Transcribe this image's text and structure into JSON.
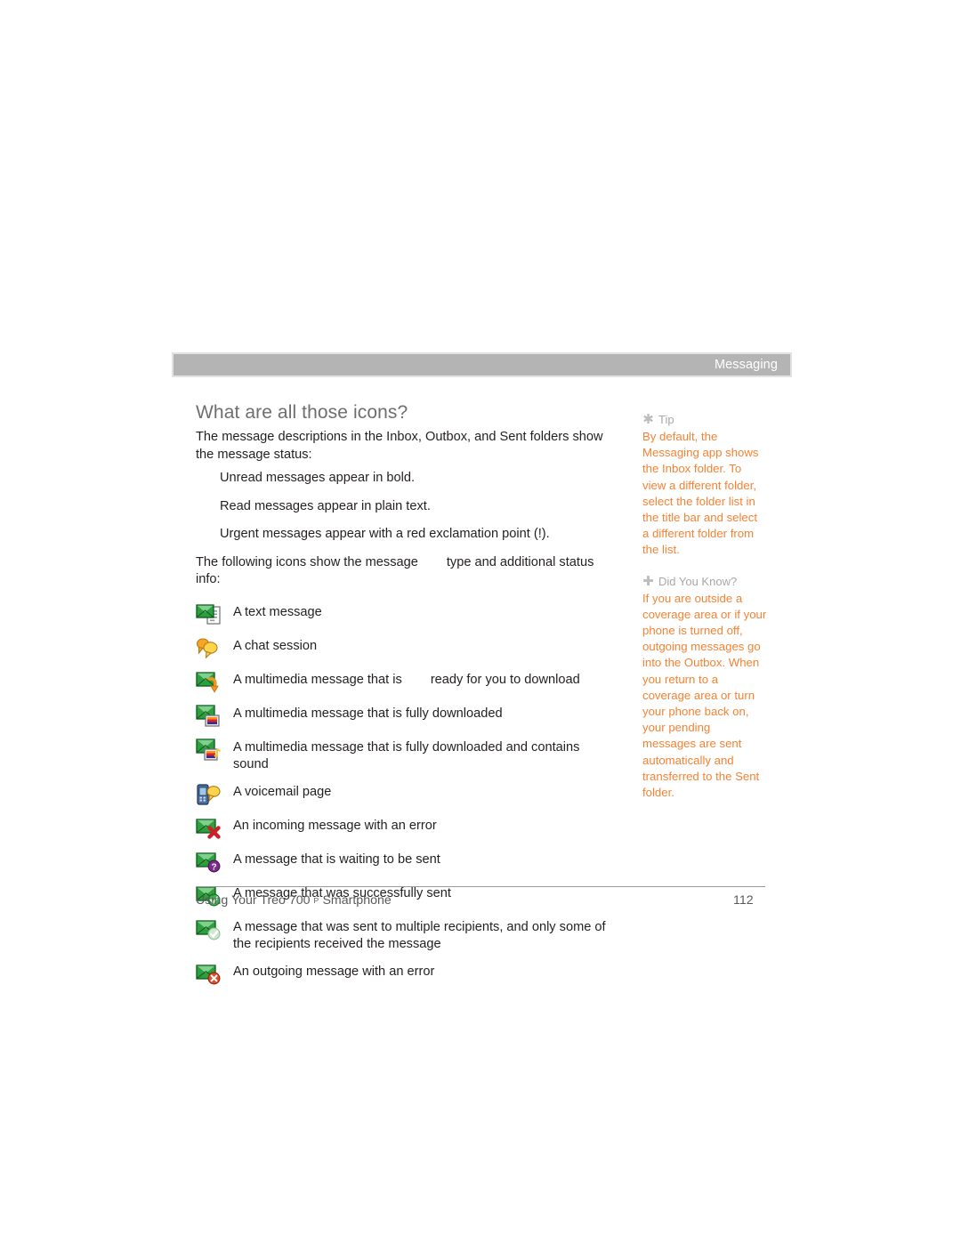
{
  "header": {
    "chapter_label": "Messaging",
    "band_color": "#b4b4b4"
  },
  "main": {
    "section_title": "What are all those icons?",
    "intro_paragraph": "The message descriptions in the Inbox, Outbox, and Sent folders show the message status:",
    "status_items": [
      "Unread messages appear in bold.",
      "Read messages appear in plain text.",
      "Urgent messages appear with a red exclamation point (!)."
    ],
    "icons_lead_before": "The following icons show the message",
    "icons_lead_after": "type and additional status info:",
    "legend": [
      {
        "icon": "text-message-icon",
        "description": "A text message"
      },
      {
        "icon": "chat-session-icon",
        "description": "A chat session"
      },
      {
        "icon": "mms-ready-to-download-icon",
        "description_before": "A multimedia message that is",
        "description_after": "ready for you to download"
      },
      {
        "icon": "mms-downloaded-icon",
        "description": "A multimedia message that is fully downloaded"
      },
      {
        "icon": "mms-downloaded-sound-icon",
        "description": "A multimedia message that is fully downloaded and contains sound"
      },
      {
        "icon": "voicemail-page-icon",
        "description": "A voicemail page"
      },
      {
        "icon": "incoming-error-icon",
        "description": "An incoming message with an error"
      },
      {
        "icon": "waiting-to-send-icon",
        "description": "A message that is waiting to be sent"
      },
      {
        "icon": "sent-success-icon",
        "description": "A message that was successfully sent"
      },
      {
        "icon": "sent-partial-icon",
        "description": "A message that was sent to multiple recipients, and only some of the recipients received the message"
      },
      {
        "icon": "outgoing-error-icon",
        "description": "An outgoing message with an error"
      }
    ]
  },
  "sidebar": {
    "notes": [
      {
        "icon": "asterisk-icon",
        "glyph": "✱",
        "heading": "Tip",
        "body": "By default, the Messaging app shows the Inbox folder. To view a different folder, select the folder list in the title bar and select a different folder from the list."
      },
      {
        "icon": "plus-icon",
        "glyph": "✚",
        "heading": "Did You Know?",
        "body": "If you are outside a coverage area or if your phone is turned off, outgoing messages go into the Outbox. When you return to a coverage area or turn your phone back on, your pending messages are sent automatically and transferred to the Sent folder."
      }
    ],
    "accent_color": "#f58233",
    "heading_color": "#a8a8a8"
  },
  "footer": {
    "title_before": "Using Your Treo 700",
    "title_superscript": "P",
    "title_after": "Smartphone",
    "page_number": "112"
  }
}
